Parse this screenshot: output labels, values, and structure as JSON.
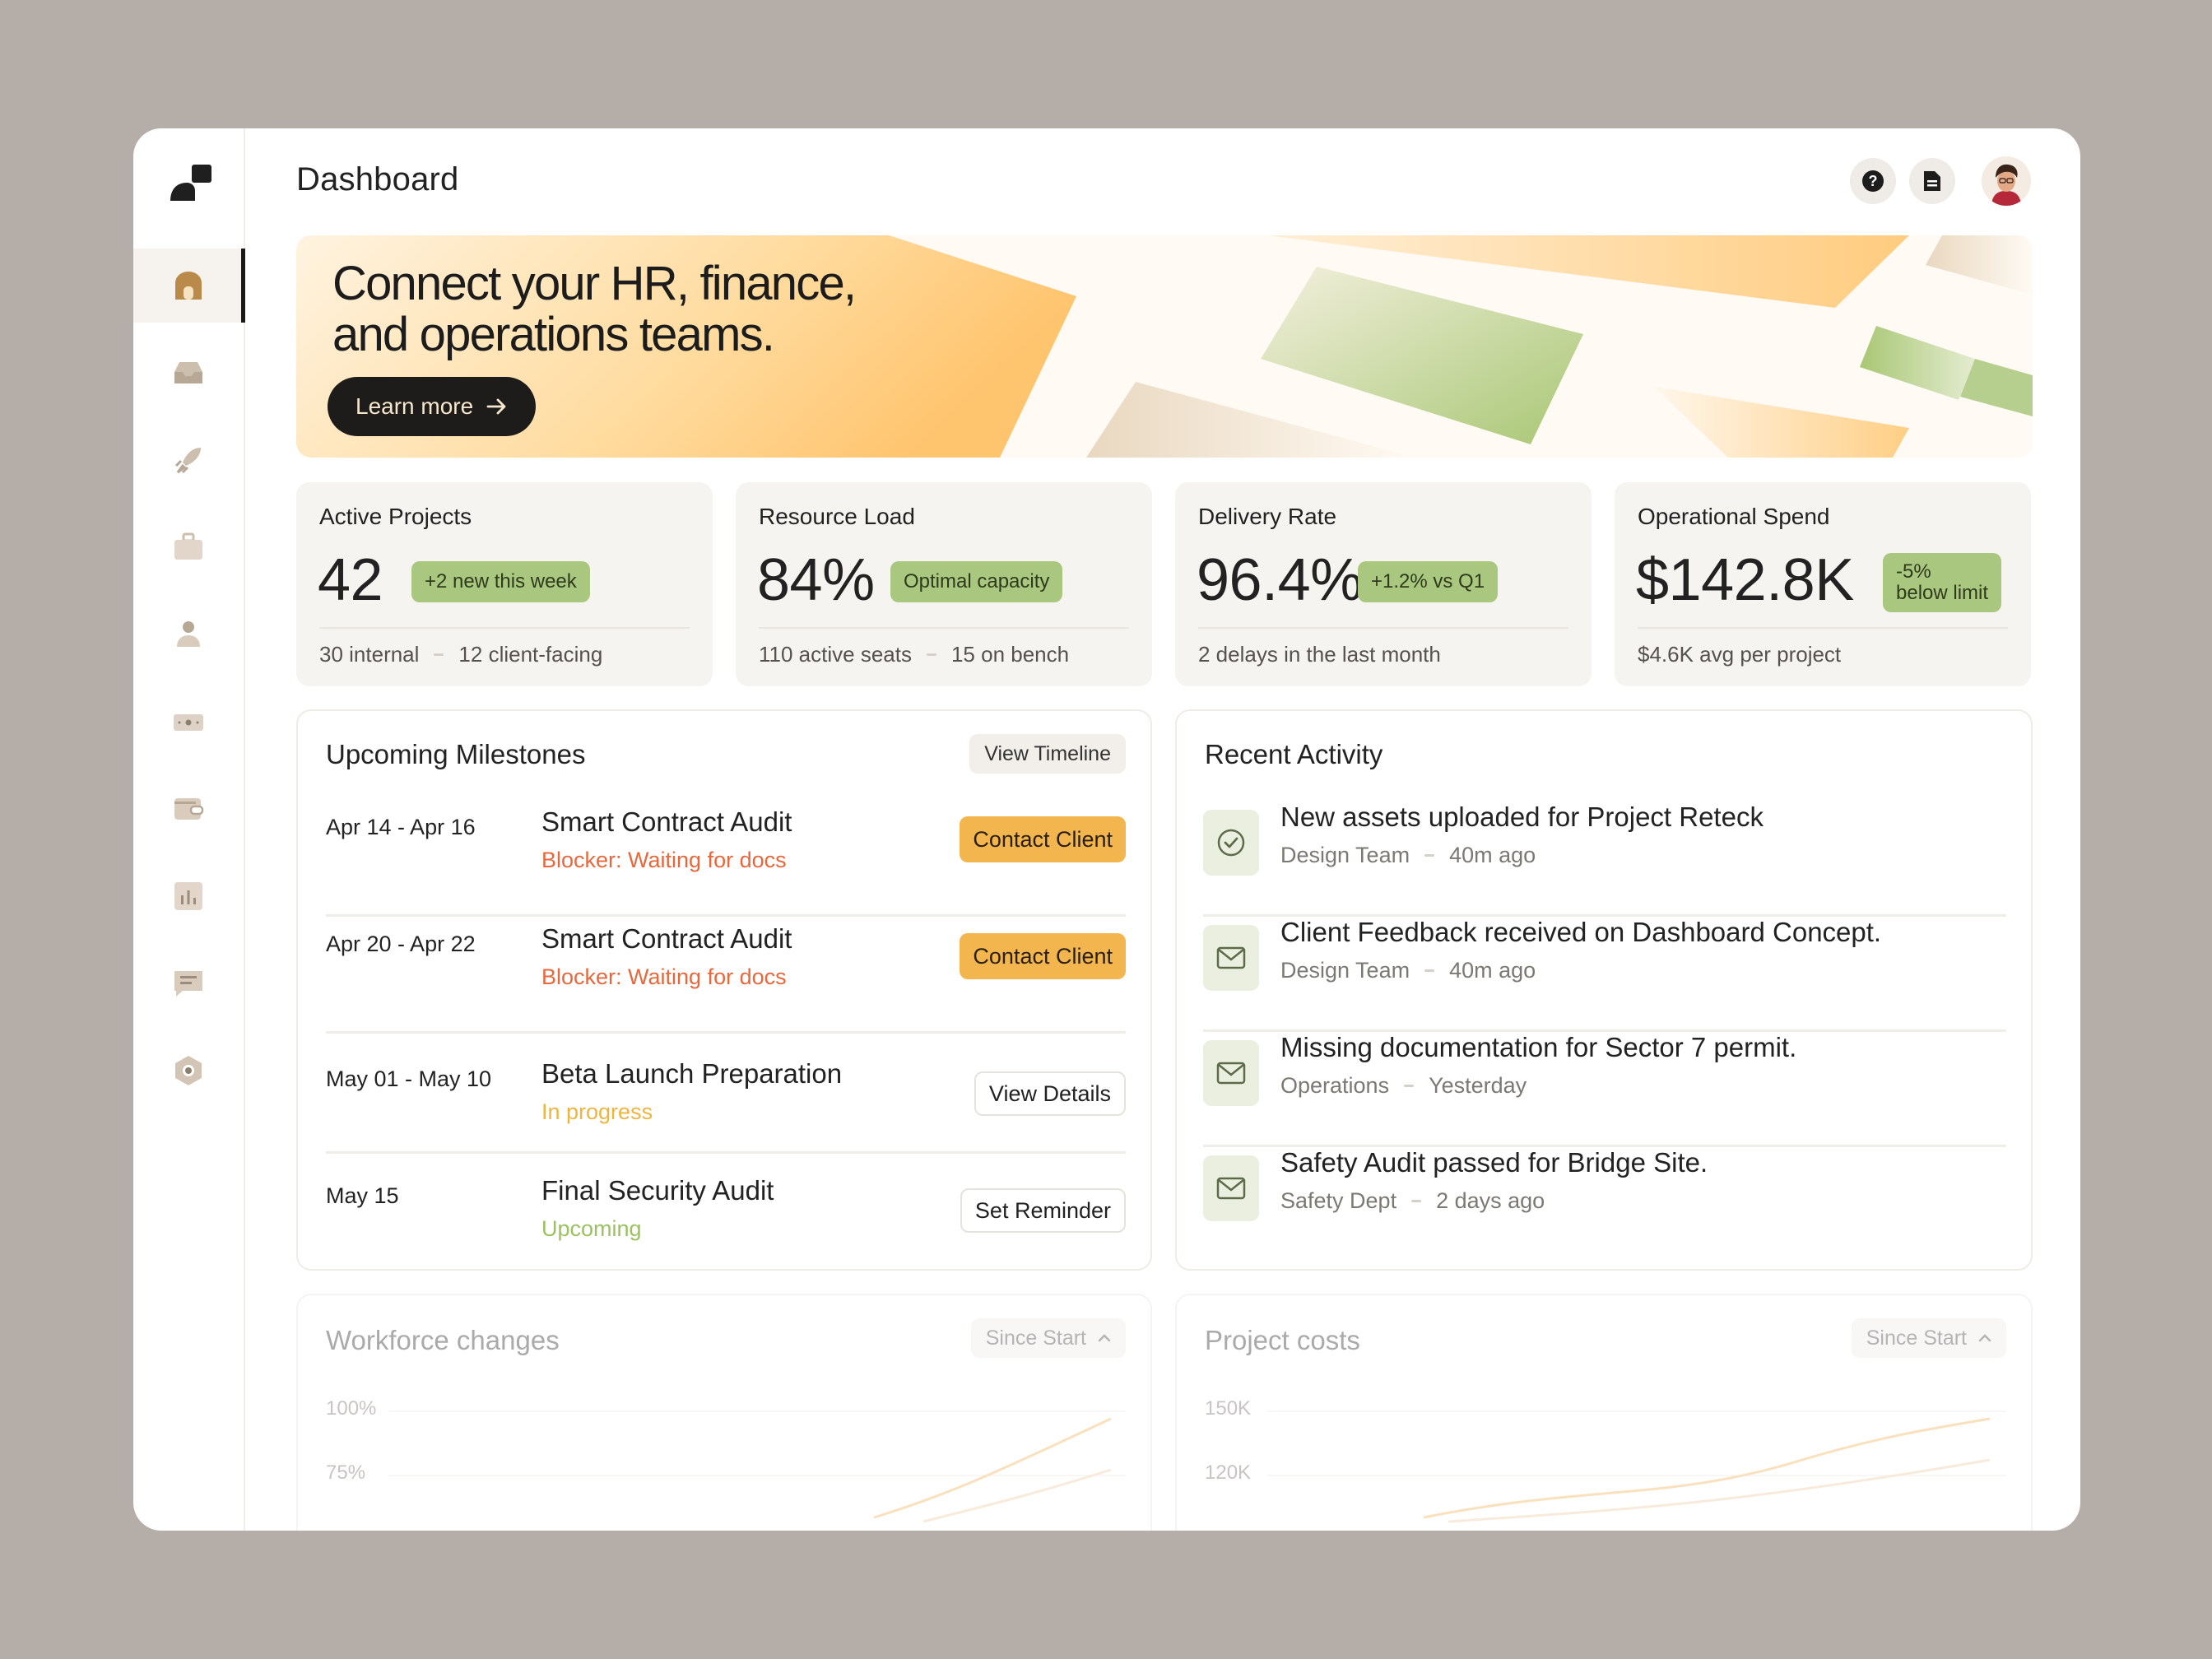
{
  "header": {
    "title": "Dashboard"
  },
  "sidebar": {
    "items": [
      {
        "icon": "home-icon",
        "active": true
      },
      {
        "icon": "inbox-icon"
      },
      {
        "icon": "rocket-icon"
      },
      {
        "icon": "briefcase-icon"
      },
      {
        "icon": "users-icon"
      },
      {
        "icon": "money-icon"
      },
      {
        "icon": "wallet-icon"
      },
      {
        "icon": "chart-icon"
      },
      {
        "icon": "message-icon"
      },
      {
        "icon": "settings-icon"
      }
    ]
  },
  "banner": {
    "title_line1": "Connect your HR, finance,",
    "title_line2": "and operations teams.",
    "button": "Learn more"
  },
  "stats": [
    {
      "label": "Active Projects",
      "value": "42",
      "badge": "+2 new this week",
      "sub_a": "30 internal",
      "sub_b": "12 client-facing"
    },
    {
      "label": "Resource Load",
      "value": "84%",
      "badge": "Optimal capacity",
      "sub_a": "110 active seats",
      "sub_b": "15 on bench"
    },
    {
      "label": "Delivery Rate",
      "value": "96.4%",
      "badge": "+1.2% vs Q1",
      "sub_a": "2 delays in the last month"
    },
    {
      "label": "Operational Spend",
      "value": "$142.8K",
      "badge_line1": "-5%",
      "badge_line2": "below limit",
      "sub_a": "$4.6K avg per project"
    }
  ],
  "milestones": {
    "title": "Upcoming Milestones",
    "action": "View Timeline",
    "items": [
      {
        "date": "Apr 14 - Apr 16",
        "title": "Smart Contract Audit",
        "status": "Blocker: Waiting for docs",
        "button": "Contact Client"
      },
      {
        "date": "Apr 20 - Apr 22",
        "title": "Smart Contract Audit",
        "status": "Blocker: Waiting for docs",
        "button": "Contact Client"
      },
      {
        "date": "May 01 - May 10",
        "title": "Beta Launch Preparation",
        "status": "In progress",
        "button": "View Details"
      },
      {
        "date": "May 15",
        "title": "Final Security Audit",
        "status": "Upcoming",
        "button": "Set Reminder"
      }
    ]
  },
  "activity": {
    "title": "Recent Activity",
    "items": [
      {
        "icon": "check-circle-icon",
        "title": "New assets uploaded for Project Reteck",
        "team": "Design Team",
        "time": "40m ago"
      },
      {
        "icon": "mail-icon",
        "title": "Client Feedback received on Dashboard Concept.",
        "team": "Design Team",
        "time": "40m ago"
      },
      {
        "icon": "mail-icon",
        "title": "Missing documentation for Sector 7 permit.",
        "team": "Operations",
        "time": "Yesterday"
      },
      {
        "icon": "mail-icon",
        "title": "Safety Audit passed for Bridge Site.",
        "team": "Safety Dept",
        "time": "2 days ago"
      }
    ]
  },
  "workforce": {
    "title": "Workforce changes",
    "range": "Since Start",
    "ticks": [
      "100%",
      "75%"
    ]
  },
  "costs": {
    "title": "Project costs",
    "range": "Since Start",
    "ticks": [
      "150K",
      "120K"
    ]
  },
  "colors": {
    "accent_orange": "#f3b54e",
    "badge_green": "#a9c77f",
    "blocker_red": "#e8683d",
    "progress_yellow": "#efb53f",
    "upcoming_green": "#9bc25e"
  }
}
